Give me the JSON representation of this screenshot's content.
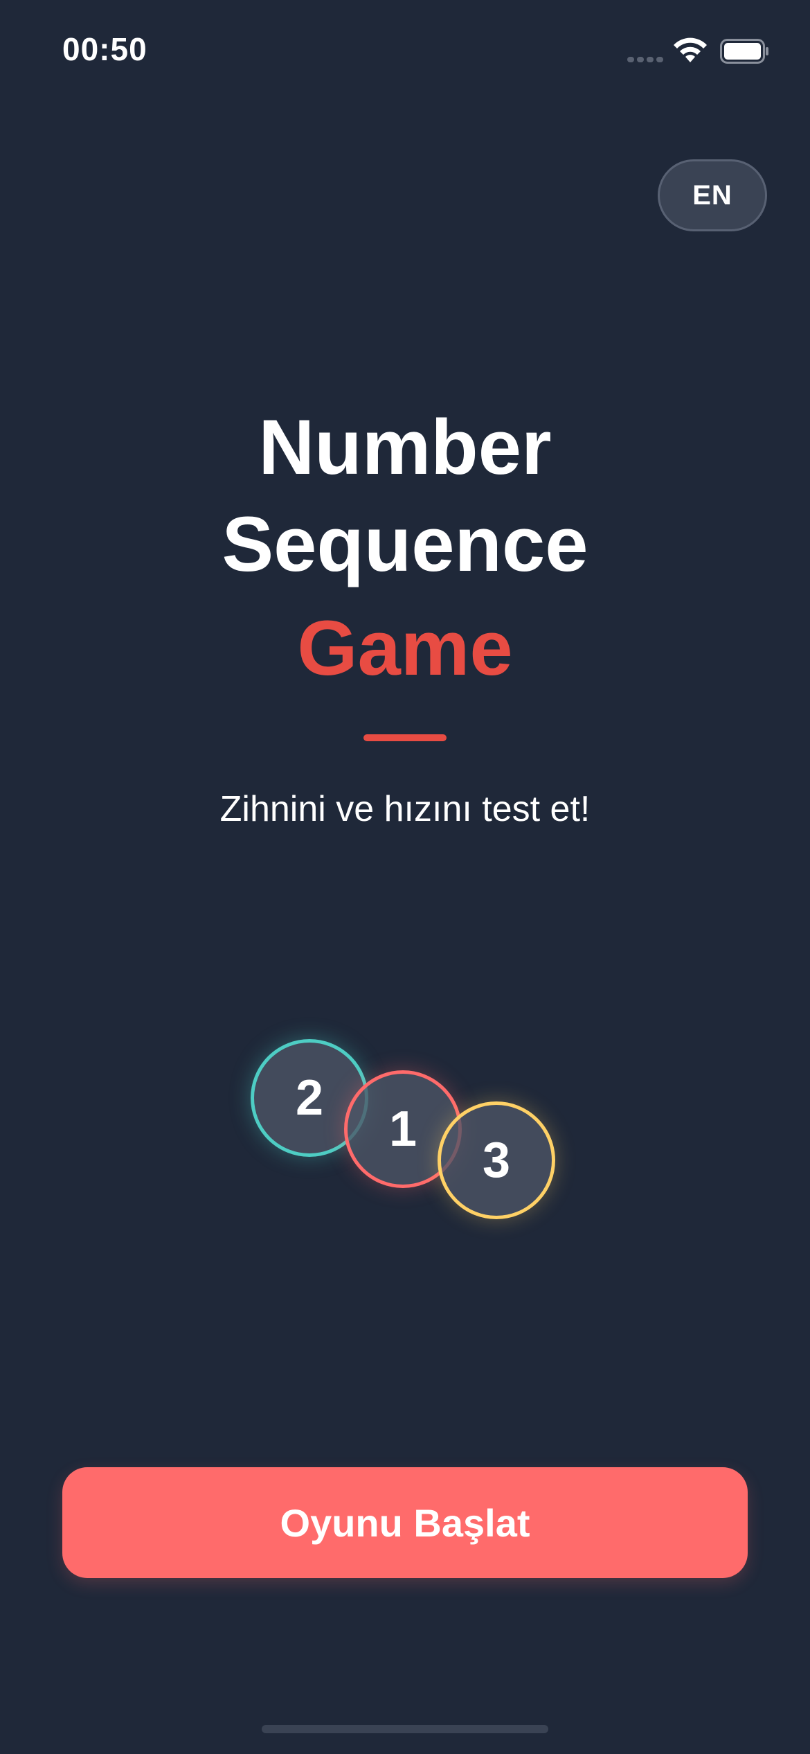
{
  "status_bar": {
    "time": "00:50",
    "icons": [
      "signal-icon",
      "wifi-icon",
      "battery-icon"
    ]
  },
  "language_button": {
    "label": "EN"
  },
  "title": {
    "line1": "Number",
    "line2": "Sequence",
    "line3": "Game"
  },
  "subtitle": "Zihnini ve hızını test et!",
  "number_circles": [
    {
      "number": "2",
      "color": "#4ecdc4"
    },
    {
      "number": "1",
      "color": "#ff6b6b"
    },
    {
      "number": "3",
      "color": "#ffd166"
    }
  ],
  "start_button": {
    "label": "Oyunu Başlat"
  },
  "colors": {
    "background": "#1f2839",
    "accent": "#e84c43",
    "button": "#ff6b6b"
  }
}
